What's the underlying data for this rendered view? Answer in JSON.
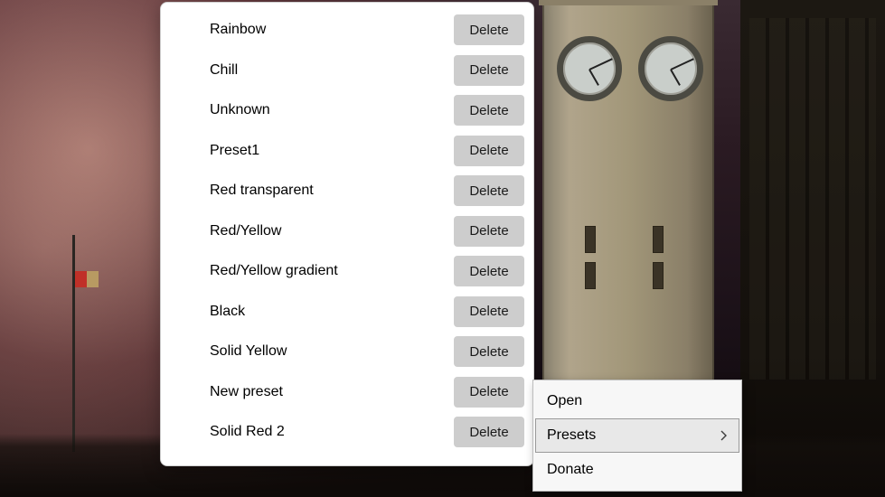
{
  "presets": [
    {
      "name": "Rainbow"
    },
    {
      "name": "Chill"
    },
    {
      "name": "Unknown"
    },
    {
      "name": "Preset1"
    },
    {
      "name": "Red transparent"
    },
    {
      "name": "Red/Yellow"
    },
    {
      "name": "Red/Yellow gradient"
    },
    {
      "name": "Black"
    },
    {
      "name": "Solid Yellow"
    },
    {
      "name": "New preset"
    },
    {
      "name": "Solid Red 2"
    }
  ],
  "delete_label": "Delete",
  "context_menu": {
    "items": [
      {
        "label": "Open",
        "has_submenu": false,
        "highlighted": false
      },
      {
        "label": "Presets",
        "has_submenu": true,
        "highlighted": true
      },
      {
        "label": "Donate",
        "has_submenu": false,
        "highlighted": false
      }
    ]
  }
}
